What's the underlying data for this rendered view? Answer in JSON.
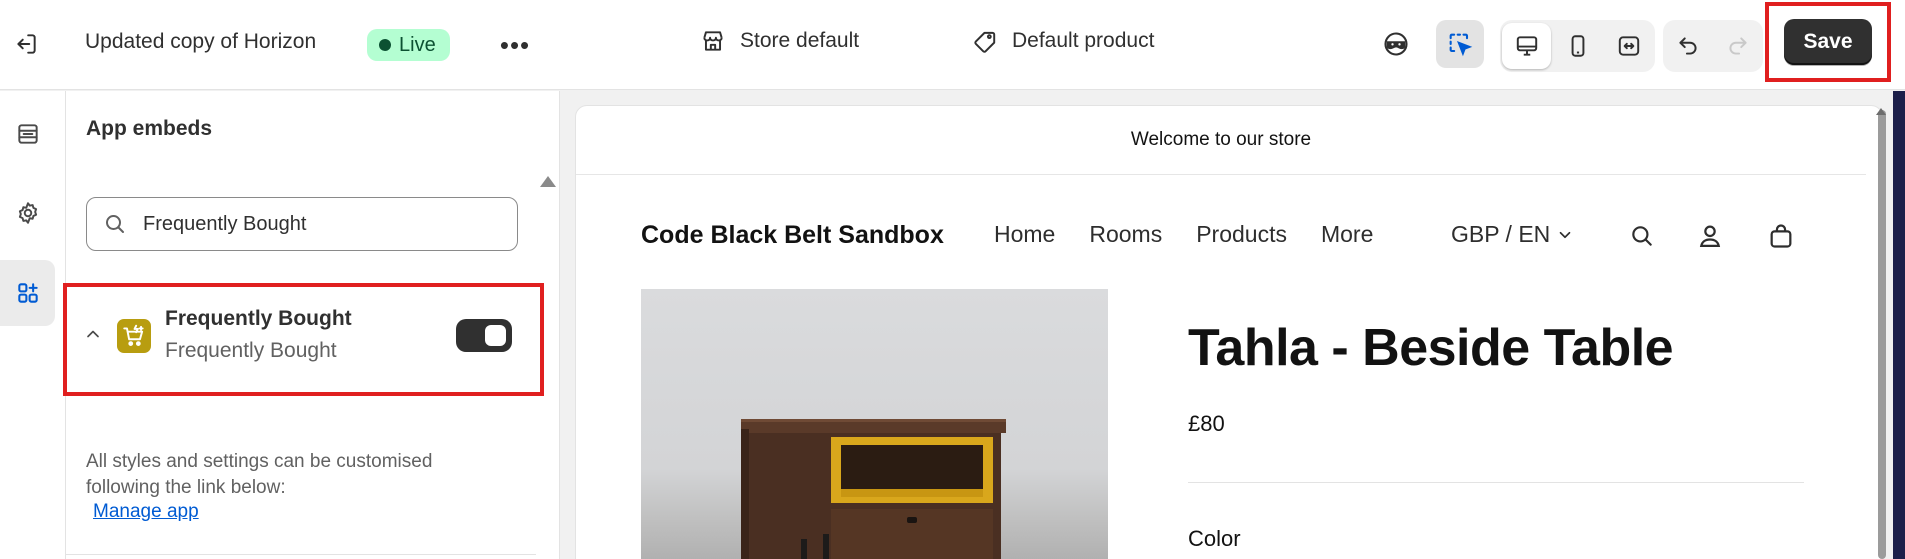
{
  "topbar": {
    "theme_name": "Updated copy of Horizon",
    "status_badge": "Live",
    "more_label": "•••",
    "store_selector": "Store default",
    "product_selector": "Default product",
    "save_label": "Save"
  },
  "sidebar": {
    "title": "App embeds",
    "search": {
      "value": "Frequently Bought"
    },
    "embed": {
      "name": "Frequently Bought",
      "subtitle": "Frequently Bought",
      "enabled": true,
      "logo_color": "#b89d10"
    },
    "help_text": "All styles and settings can be customised following the link below:",
    "manage_link": "Manage app"
  },
  "preview": {
    "announcement": "Welcome to our store",
    "store_name": "Code Black Belt Sandbox",
    "nav": [
      "Home",
      "Rooms",
      "Products",
      "More"
    ],
    "currency": "GBP / EN",
    "product": {
      "title": "Tahla - Beside Table",
      "price": "£80",
      "option_label": "Color"
    }
  },
  "colors": {
    "accent_red": "#e01f1f",
    "live_badge_bg": "#b4fed2",
    "live_badge_text": "#0c5132",
    "primary_button": "#303030",
    "link": "#005bd3"
  }
}
